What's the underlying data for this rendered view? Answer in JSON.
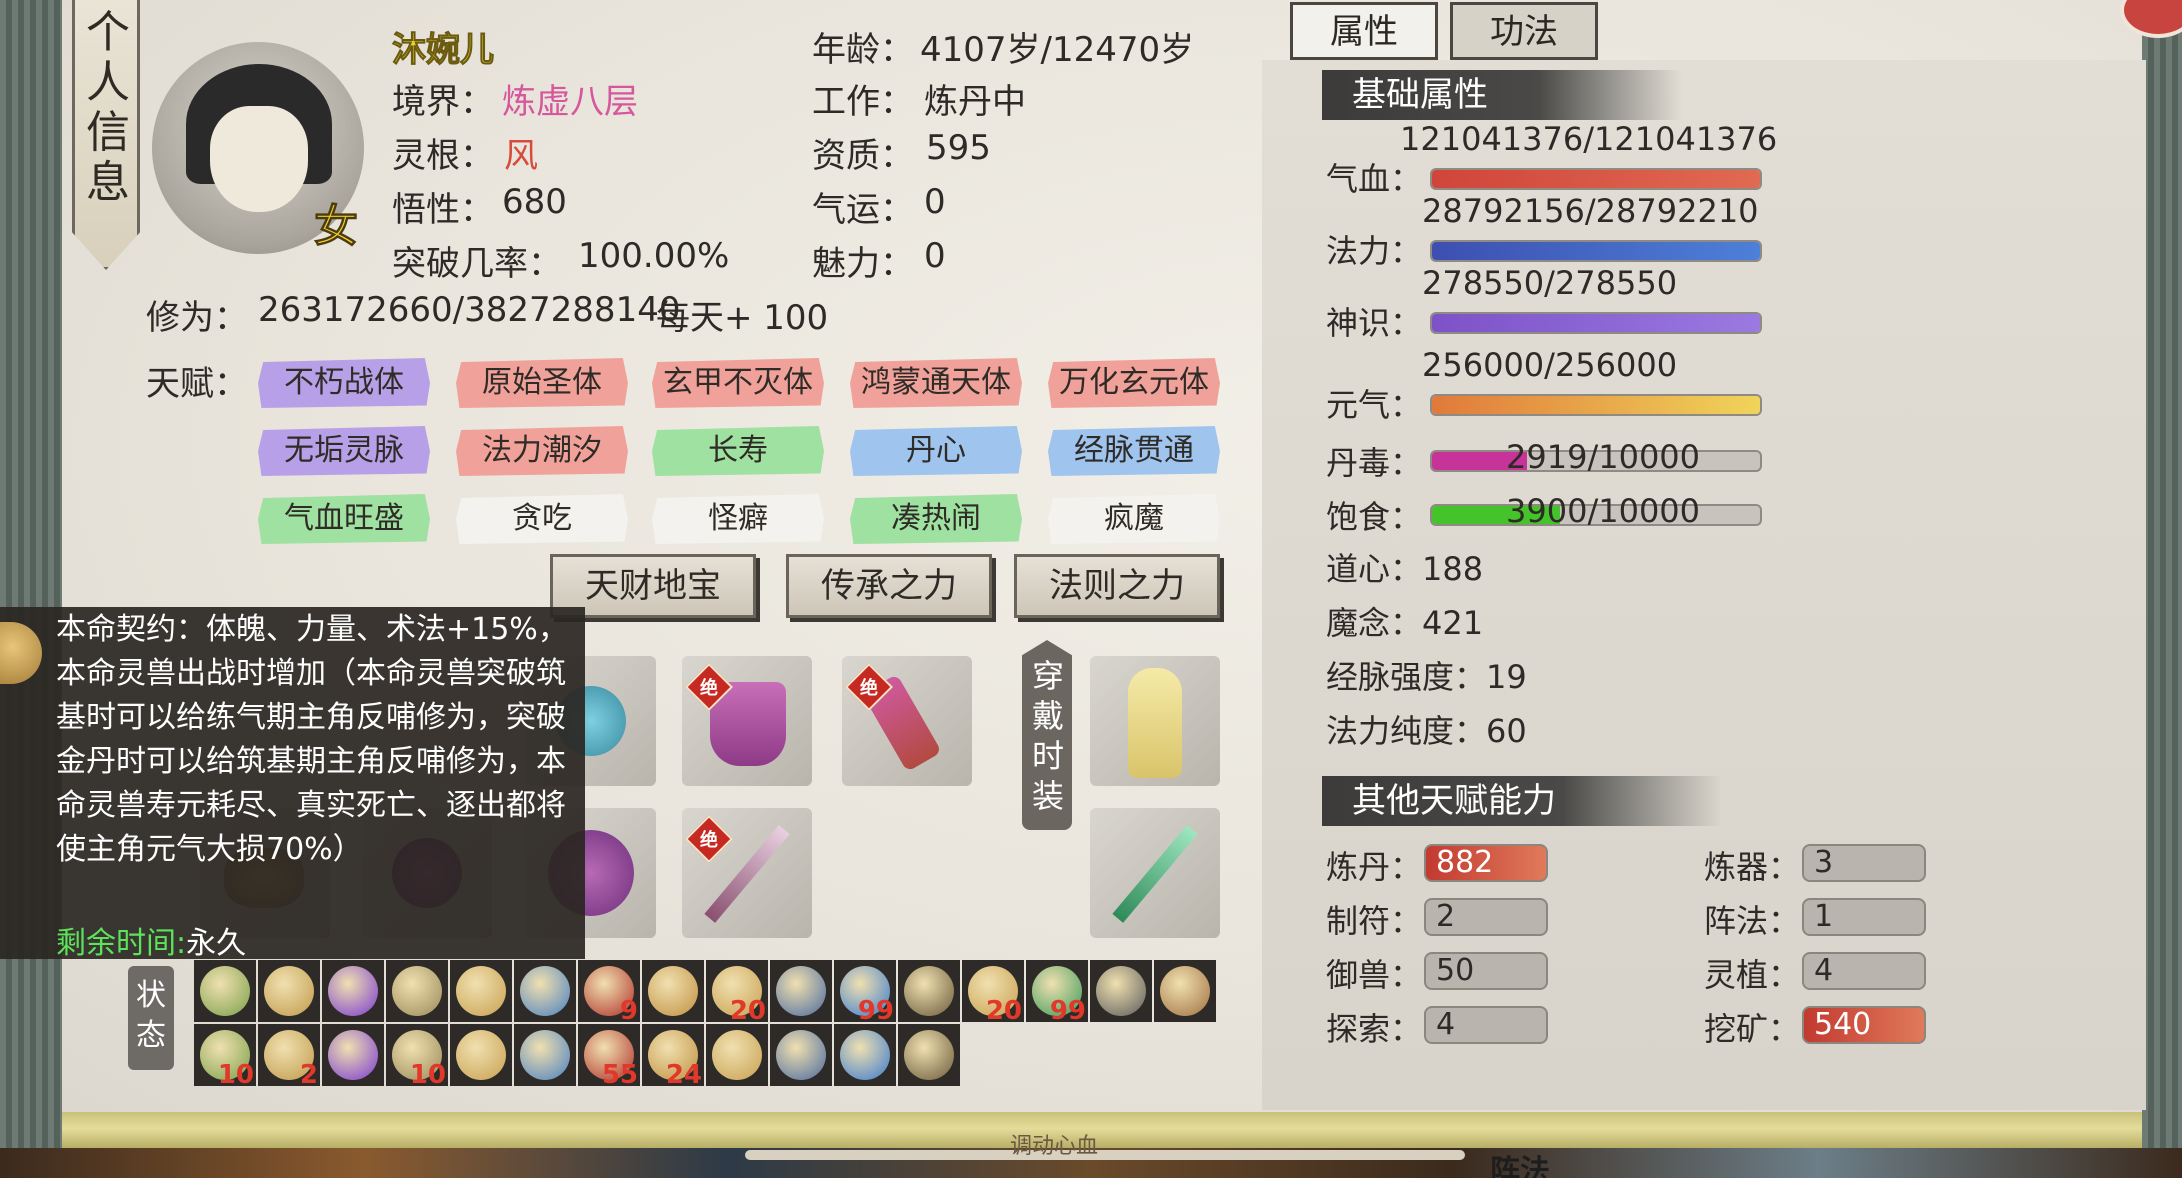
{
  "window": {
    "vertical_tab": "个人信息"
  },
  "profile": {
    "name": "沐婉儿",
    "gender": "女",
    "realm_label": "境界：",
    "realm": "炼虚八层",
    "root_label": "灵根：",
    "root": "风",
    "comprehension_label": "悟性：",
    "comprehension": "680",
    "breakthrough_label": "突破几率：",
    "breakthrough": "100.00%",
    "age_label": "年龄：",
    "age": "4107岁/12470岁",
    "job_label": "工作：",
    "job": "炼丹中",
    "aptitude_label": "资质：",
    "aptitude": "595",
    "luck_label": "气运：",
    "luck": "0",
    "charm_label": "魅力：",
    "charm": "0",
    "cultivation_label": "修为：",
    "cultivation": "263172660/3827288140",
    "daily": "每天+ 100"
  },
  "talents": {
    "label": "天赋：",
    "items": [
      {
        "text": "不朽战体",
        "color": "purple"
      },
      {
        "text": "原始圣体",
        "color": "salmon"
      },
      {
        "text": "玄甲不灭体",
        "color": "salmon"
      },
      {
        "text": "鸿蒙通天体",
        "color": "salmon"
      },
      {
        "text": "万化玄元体",
        "color": "salmon"
      },
      {
        "text": "无垢灵脉",
        "color": "purple"
      },
      {
        "text": "法力潮汐",
        "color": "salmon"
      },
      {
        "text": "长寿",
        "color": "green"
      },
      {
        "text": "丹心",
        "color": "blue"
      },
      {
        "text": "经脉贯通",
        "color": "blue"
      },
      {
        "text": "气血旺盛",
        "color": "green"
      },
      {
        "text": "贪吃",
        "color": "white"
      },
      {
        "text": "怪癖",
        "color": "white"
      },
      {
        "text": "凑热闹",
        "color": "green"
      },
      {
        "text": "疯魔",
        "color": "white"
      }
    ]
  },
  "actions": {
    "treasure": "天财地宝",
    "inherit": "传承之力",
    "law": "法则之力"
  },
  "tooltip": {
    "text": "本命契约：体魄、力量、术法+15%，本命灵兽出战时增加（本命灵兽突破筑基时可以给练气期主角反哺修为，突破金丹时可以给筑基期主角反哺修为，本命灵兽寿元耗尽、真实死亡、逐出都将使主角元气大损70%）",
    "time_label": "剩余时间:",
    "time_value": "永久"
  },
  "equipment": {
    "wear_tab": "穿戴时装",
    "tag": "绝",
    "items": [
      "spirit-pet-icon",
      "boots-icon",
      "scroll-icon",
      "fashion-robe-icon",
      "beast-icon",
      "orb-icon",
      "flower-icon",
      "sword-icon",
      "jade-sword-icon"
    ]
  },
  "status": {
    "label": "状态",
    "icons": [
      {
        "icon": "leaf-buff-icon",
        "count": ""
      },
      {
        "icon": "lotus-buff-icon",
        "count": ""
      },
      {
        "icon": "void-buff-icon",
        "count": ""
      },
      {
        "icon": "bell-buff-icon",
        "count": ""
      },
      {
        "icon": "coin-buff-icon",
        "count": ""
      },
      {
        "icon": "moon-card-icon",
        "count": ""
      },
      {
        "icon": "rose-buff-icon",
        "count": "9"
      },
      {
        "icon": "sun-buff-icon",
        "count": ""
      },
      {
        "icon": "coin-buff-icon",
        "count": "20"
      },
      {
        "icon": "crest-buff-icon",
        "count": ""
      },
      {
        "icon": "wave-buff-icon",
        "count": "99"
      },
      {
        "icon": "meditate-buff-icon",
        "count": ""
      },
      {
        "icon": "coin-buff-icon",
        "count": "20"
      },
      {
        "icon": "jade-buff-icon",
        "count": "99"
      },
      {
        "icon": "stone-buff-icon",
        "count": ""
      },
      {
        "icon": "flame-buff-icon",
        "count": ""
      },
      {
        "icon": "coin-buff-icon",
        "count": "10"
      },
      {
        "icon": "muscle-buff-icon",
        "count": "2"
      },
      {
        "icon": "flame-buff-icon",
        "count": ""
      },
      {
        "icon": "coin-buff-icon",
        "count": "10"
      },
      {
        "icon": "flame-buff-icon",
        "count": ""
      },
      {
        "icon": "coin-buff-icon",
        "count": ""
      },
      {
        "icon": "gold-buff-icon",
        "count": "55"
      },
      {
        "icon": "galaxy-buff-icon",
        "count": "24"
      },
      {
        "icon": "frost-buff-icon",
        "count": ""
      },
      {
        "icon": "gourd-buff-icon",
        "count": ""
      },
      {
        "icon": "coin-buff-icon",
        "count": ""
      },
      {
        "icon": "ice-buff-icon",
        "count": ""
      }
    ]
  },
  "right": {
    "tab_attr": "属性",
    "tab_skill": "功法",
    "base_header": "基础属性",
    "bars": [
      {
        "label": "气血：",
        "text": "121041376/121041376",
        "ratio": 1.0,
        "color": "#d0453a",
        "color2": "#e06a52"
      },
      {
        "label": "法力：",
        "text": "28792156/28792210",
        "ratio": 1.0,
        "color": "#3d4fb0",
        "color2": "#4d80d8"
      },
      {
        "label": "神识：",
        "text": "278550/278550",
        "ratio": 1.0,
        "color": "#7d52c8",
        "color2": "#9a7ae0"
      },
      {
        "label": "元气：",
        "text": "256000/256000",
        "ratio": 1.0,
        "color": "#e07a3a",
        "color2": "#f0d45a"
      }
    ],
    "gauges": [
      {
        "label": "丹毒：",
        "text": "2919/10000",
        "ratio": 0.29,
        "color": "#c8339a"
      },
      {
        "label": "饱食：",
        "text": "3900/10000",
        "ratio": 0.39,
        "color": "#44c42a"
      }
    ],
    "stats": [
      {
        "label": "道心：",
        "value": "188"
      },
      {
        "label": "魔念：",
        "value": "421"
      },
      {
        "label": "经脉强度：",
        "value": "19"
      },
      {
        "label": "法力纯度：",
        "value": "60"
      }
    ],
    "other_header": "其他天赋能力",
    "abilities": [
      {
        "label": "炼丹：",
        "value": "882",
        "hot": true
      },
      {
        "label": "炼器：",
        "value": "3",
        "hot": false
      },
      {
        "label": "制符：",
        "value": "2",
        "hot": false
      },
      {
        "label": "阵法：",
        "value": "1",
        "hot": false
      },
      {
        "label": "御兽：",
        "value": "50",
        "hot": false
      },
      {
        "label": "灵植：",
        "value": "4",
        "hot": false
      },
      {
        "label": "探索：",
        "value": "4",
        "hot": false
      },
      {
        "label": "挖矿：",
        "value": "540",
        "hot": true
      }
    ]
  },
  "footer": {
    "label": "调动心血",
    "badge": "阵法"
  }
}
